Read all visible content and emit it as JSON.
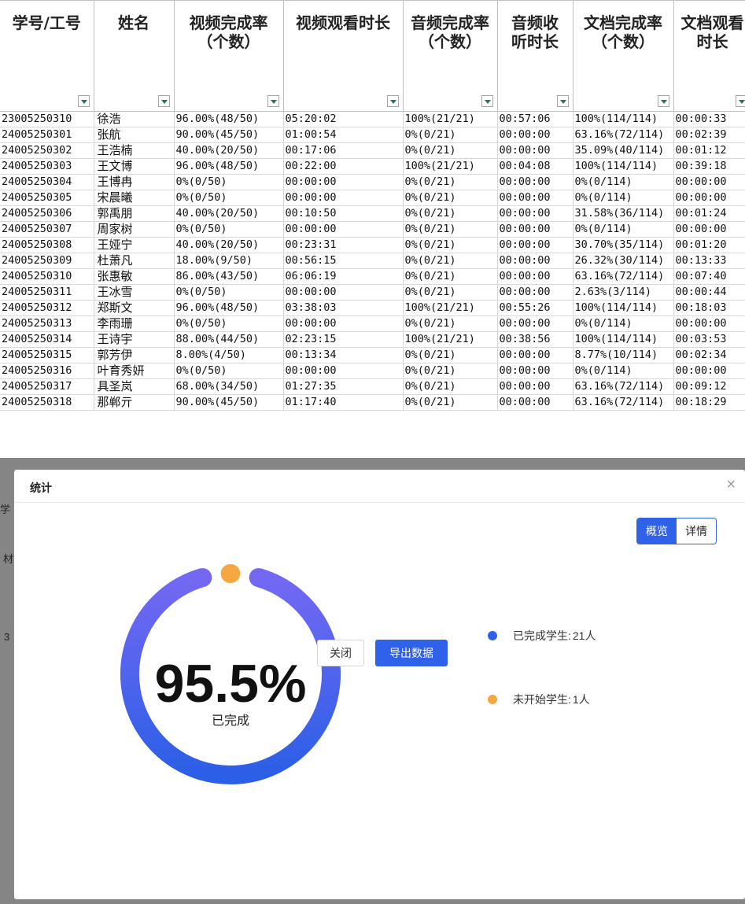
{
  "sheet": {
    "headers": [
      "学号/工号",
      "姓名",
      "视频完成率\n（个数）",
      "视频观看时长",
      "音频完成率\n（个数）",
      "音频收\n听时长",
      "文档完成率\n（个数）",
      "文档观看\n时长"
    ],
    "rows": [
      [
        "23005250310",
        "徐浩",
        "96.00%(48/50)",
        "05:20:02",
        "100%(21/21)",
        "00:57:06",
        "100%(114/114)",
        "00:00:33"
      ],
      [
        "24005250301",
        "张航",
        "90.00%(45/50)",
        "01:00:54",
        "0%(0/21)",
        "00:00:00",
        "63.16%(72/114)",
        "00:02:39"
      ],
      [
        "24005250302",
        "王浩楠",
        "40.00%(20/50)",
        "00:17:06",
        "0%(0/21)",
        "00:00:00",
        "35.09%(40/114)",
        "00:01:12"
      ],
      [
        "24005250303",
        "王文博",
        "96.00%(48/50)",
        "00:22:00",
        "100%(21/21)",
        "00:04:08",
        "100%(114/114)",
        "00:39:18"
      ],
      [
        "24005250304",
        "王博冉",
        "0%(0/50)",
        "00:00:00",
        "0%(0/21)",
        "00:00:00",
        "0%(0/114)",
        "00:00:00"
      ],
      [
        "24005250305",
        "宋晨曦",
        "0%(0/50)",
        "00:00:00",
        "0%(0/21)",
        "00:00:00",
        "0%(0/114)",
        "00:00:00"
      ],
      [
        "24005250306",
        "郭禹朋",
        "40.00%(20/50)",
        "00:10:50",
        "0%(0/21)",
        "00:00:00",
        "31.58%(36/114)",
        "00:01:24"
      ],
      [
        "24005250307",
        "周家树",
        "0%(0/50)",
        "00:00:00",
        "0%(0/21)",
        "00:00:00",
        "0%(0/114)",
        "00:00:00"
      ],
      [
        "24005250308",
        "王娅宁",
        "40.00%(20/50)",
        "00:23:31",
        "0%(0/21)",
        "00:00:00",
        "30.70%(35/114)",
        "00:01:20"
      ],
      [
        "24005250309",
        "杜萧凡",
        "18.00%(9/50)",
        "00:56:15",
        "0%(0/21)",
        "00:00:00",
        "26.32%(30/114)",
        "00:13:33"
      ],
      [
        "24005250310",
        "张惠敏",
        "86.00%(43/50)",
        "06:06:19",
        "0%(0/21)",
        "00:00:00",
        "63.16%(72/114)",
        "00:07:40"
      ],
      [
        "24005250311",
        "王冰雪",
        "0%(0/50)",
        "00:00:00",
        "0%(0/21)",
        "00:00:00",
        "2.63%(3/114)",
        "00:00:44"
      ],
      [
        "24005250312",
        "郑斯文",
        "96.00%(48/50)",
        "03:38:03",
        "100%(21/21)",
        "00:55:26",
        "100%(114/114)",
        "00:18:03"
      ],
      [
        "24005250313",
        "李雨珊",
        "0%(0/50)",
        "00:00:00",
        "0%(0/21)",
        "00:00:00",
        "0%(0/114)",
        "00:00:00"
      ],
      [
        "24005250314",
        "王诗宇",
        "88.00%(44/50)",
        "02:23:15",
        "100%(21/21)",
        "00:38:56",
        "100%(114/114)",
        "00:03:53"
      ],
      [
        "24005250315",
        "郭芳伊",
        "8.00%(4/50)",
        "00:13:34",
        "0%(0/21)",
        "00:00:00",
        "8.77%(10/114)",
        "00:02:34"
      ],
      [
        "24005250316",
        "叶育秀妍",
        "0%(0/50)",
        "00:00:00",
        "0%(0/21)",
        "00:00:00",
        "0%(0/114)",
        "00:00:00"
      ],
      [
        "24005250317",
        "具圣岚",
        "68.00%(34/50)",
        "01:27:35",
        "0%(0/21)",
        "00:00:00",
        "63.16%(72/114)",
        "00:09:12"
      ],
      [
        "24005250318",
        "那郸亓",
        "90.00%(45/50)",
        "01:17:40",
        "0%(0/21)",
        "00:00:00",
        "63.16%(72/114)",
        "00:18:29"
      ]
    ]
  },
  "backdrop": {
    "frag_left_1": "学",
    "frag_left_2": "材",
    "frag_left_3": "3"
  },
  "dialog": {
    "title": "统计",
    "close_icon": "close-icon",
    "tabs": [
      {
        "label": "概览",
        "active": true
      },
      {
        "label": "详情",
        "active": false
      }
    ],
    "percent": "95.5%",
    "percent_label": "已完成",
    "legend": [
      {
        "label": "已完成学生:",
        "value": "21人",
        "color": "#2f62e8"
      },
      {
        "label": "未开始学生:",
        "value": "1人",
        "color": "#f5a742"
      }
    ],
    "close_label": "关闭",
    "export_label": "导出数据"
  },
  "chart_data": {
    "type": "pie",
    "categories": [
      "已完成学生",
      "未开始学生"
    ],
    "values": [
      21,
      1
    ],
    "colors": [
      "#2f62e8",
      "#f5a742"
    ]
  }
}
